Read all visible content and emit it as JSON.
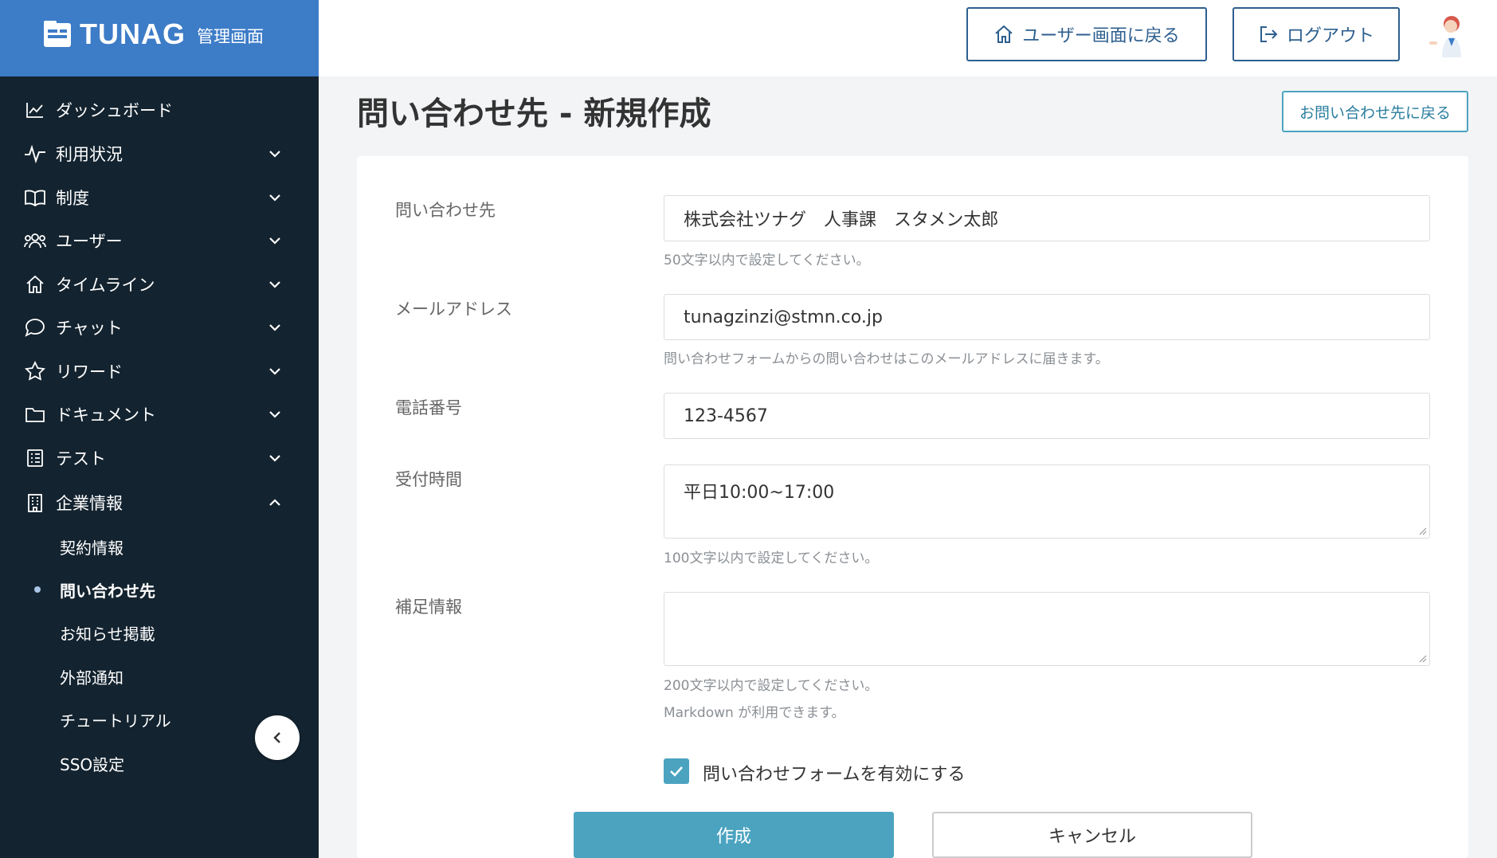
{
  "brand": {
    "name": "TUNAG",
    "subtitle": "管理画面"
  },
  "header": {
    "user_screen_button": "ユーザー画面に戻る",
    "logout_button": "ログアウト"
  },
  "sidebar": {
    "items": [
      {
        "label": "ダッシュボード",
        "icon": "chart-icon"
      },
      {
        "label": "利用状況",
        "icon": "activity-icon"
      },
      {
        "label": "制度",
        "icon": "book-icon"
      },
      {
        "label": "ユーザー",
        "icon": "users-icon"
      },
      {
        "label": "タイムライン",
        "icon": "home-icon"
      },
      {
        "label": "チャット",
        "icon": "chat-icon"
      },
      {
        "label": "リワード",
        "icon": "star-icon"
      },
      {
        "label": "ドキュメント",
        "icon": "folder-icon"
      },
      {
        "label": "テスト",
        "icon": "checklist-icon"
      },
      {
        "label": "企業情報",
        "icon": "building-icon"
      }
    ],
    "sub_items": [
      {
        "label": "契約情報"
      },
      {
        "label": "問い合わせ先",
        "active": true
      },
      {
        "label": "お知らせ掲載"
      },
      {
        "label": "外部通知"
      },
      {
        "label": "チュートリアル"
      },
      {
        "label": "SSO設定"
      }
    ]
  },
  "page": {
    "title": "問い合わせ先 - 新規作成",
    "back_button": "お問い合わせ先に戻る"
  },
  "form": {
    "contact": {
      "label": "問い合わせ先",
      "value": "株式会社ツナグ　人事課　スタメン太郎",
      "hint": "50文字以内で設定してください。"
    },
    "email": {
      "label": "メールアドレス",
      "value": "tunagzinzi@stmn.co.jp",
      "hint": "問い合わせフォームからの問い合わせはこのメールアドレスに届きます。"
    },
    "phone": {
      "label": "電話番号",
      "value": "123-4567"
    },
    "hours": {
      "label": "受付時間",
      "value": "平日10:00~17:00",
      "hint": "100文字以内で設定してください。"
    },
    "notes": {
      "label": "補足情報",
      "value": "",
      "hint": "200文字以内で設定してください。",
      "hint2": "Markdown が利用できます。"
    },
    "enable_form": {
      "label": "問い合わせフォームを有効にする",
      "checked": true
    },
    "create_button": "作成",
    "cancel_button": "キャンセル"
  },
  "colors": {
    "sidebar_bg": "#13232f",
    "brand_bg": "#3d7cc7",
    "accent": "#4ba3c0",
    "header_button": "#2d5f8f"
  }
}
